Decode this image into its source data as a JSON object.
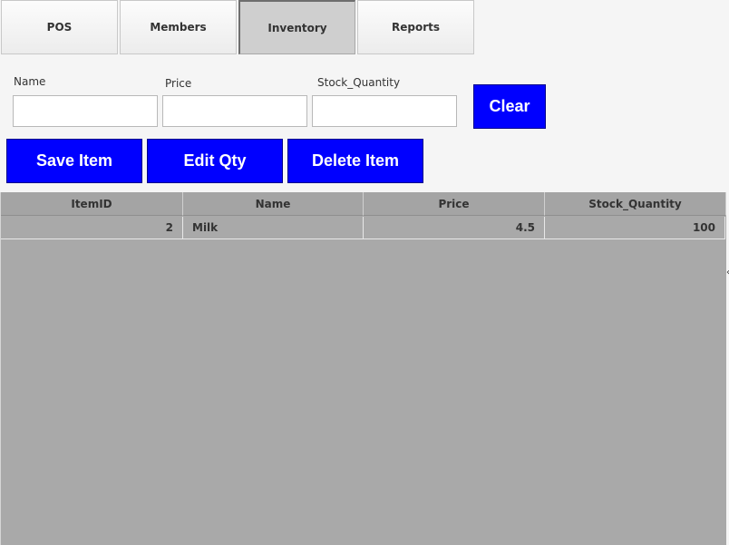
{
  "tabs": [
    {
      "label": "POS"
    },
    {
      "label": "Members"
    },
    {
      "label": "Inventory",
      "active": true
    },
    {
      "label": "Reports"
    }
  ],
  "form": {
    "name": {
      "label": "Name",
      "value": ""
    },
    "price": {
      "label": "Price",
      "value": ""
    },
    "stock": {
      "label": "Stock_Quantity",
      "value": ""
    },
    "clear_label": "Clear"
  },
  "actions": {
    "save_label": "Save Item",
    "edit_label": "Edit Qty",
    "delete_label": "Delete Item"
  },
  "table": {
    "columns": [
      "ItemID",
      "Name",
      "Price",
      "Stock_Quantity"
    ],
    "rows": [
      {
        "item_id": "2",
        "name": "Milk",
        "price": "4.5",
        "stock": "100"
      }
    ]
  },
  "colors": {
    "accent_button": "#0000ff",
    "table_background": "#a9a9a9",
    "active_tab": "#cfcfcf"
  },
  "icons": {
    "scroll_hint": "chevron-left-icon"
  }
}
